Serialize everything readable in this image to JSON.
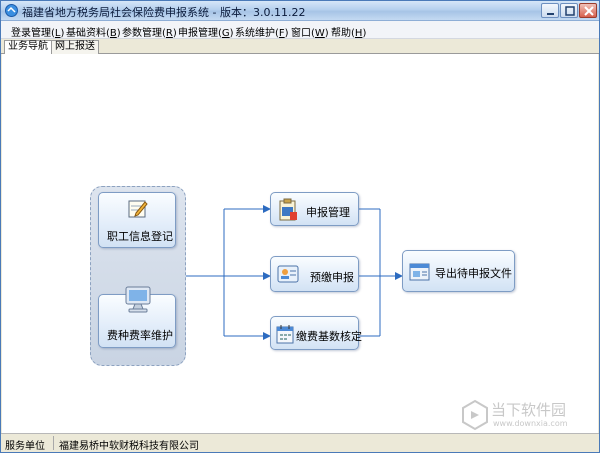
{
  "window": {
    "title": "福建省地方税务局社会保险费申报系统 - 版本：3.0.11.22"
  },
  "menu": [
    {
      "label": "登录管理(",
      "key": "L",
      "tail": ")"
    },
    {
      "label": "基础资料(",
      "key": "B",
      "tail": ")"
    },
    {
      "label": "参数管理(",
      "key": "R",
      "tail": ")"
    },
    {
      "label": "申报管理(",
      "key": "G",
      "tail": ")"
    },
    {
      "label": "系统维护(",
      "key": "F",
      "tail": ")"
    },
    {
      "label": "窗口(",
      "key": "W",
      "tail": ")"
    },
    {
      "label": "帮助(",
      "key": "H",
      "tail": ")"
    }
  ],
  "tabs": [
    {
      "label": "业务导航",
      "active": true
    },
    {
      "label": "网上报送",
      "active": false
    }
  ],
  "flow": {
    "employee_info": {
      "label": "职工信息登记",
      "icon": "notepad-pencil-icon"
    },
    "rate_maintain": {
      "label": "费种费率维护",
      "icon": "computer-monitor-icon"
    },
    "declare_manage": {
      "label": "申报管理",
      "icon": "clipboard-document-icon"
    },
    "prepay_declare": {
      "label": "预缴申报",
      "icon": "id-card-icon"
    },
    "base_verify": {
      "label": "缴费基数核定",
      "icon": "calendar-icon"
    },
    "export_file": {
      "label": "导出待申报文件",
      "icon": "export-window-icon"
    }
  },
  "status": {
    "unit_label": "服务单位",
    "unit_value": "福建易桥中软财税科技有限公司"
  },
  "watermark": {
    "text": "当下软件园",
    "url": "www.downxia.com"
  },
  "colors": {
    "accent": "#2c6bc0",
    "node_border": "#7e9cc4",
    "connector": "#2c6bc0"
  }
}
